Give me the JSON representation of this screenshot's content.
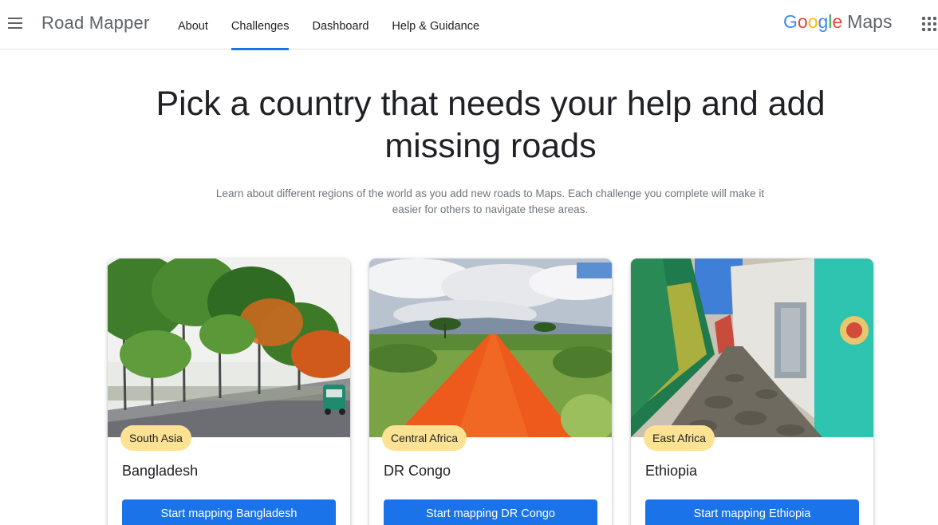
{
  "header": {
    "app_title": "Road Mapper",
    "nav": [
      {
        "label": "About",
        "active": false
      },
      {
        "label": "Challenges",
        "active": true
      },
      {
        "label": "Dashboard",
        "active": false
      },
      {
        "label": "Help & Guidance",
        "active": false
      }
    ],
    "brand": {
      "google_letters": [
        {
          "char": "G",
          "color": "#4285F4"
        },
        {
          "char": "o",
          "color": "#EA4335"
        },
        {
          "char": "o",
          "color": "#FBBC05"
        },
        {
          "char": "g",
          "color": "#4285F4"
        },
        {
          "char": "l",
          "color": "#34A853"
        },
        {
          "char": "e",
          "color": "#EA4335"
        }
      ],
      "product": "Maps"
    },
    "icons": {
      "menu": "hamburger-menu-icon",
      "apps": "apps-grid-icon"
    }
  },
  "hero": {
    "headline": "Pick a country that needs your help and add missing roads",
    "subtext": "Learn about different regions of the world as you add new roads to Maps. Each challenge you complete will make it easier for others to navigate these areas."
  },
  "cards": [
    {
      "region": "South Asia",
      "country": "Bangladesh",
      "button": "Start mapping Bangladesh",
      "image": "tree-lined road with auto-rickshaw"
    },
    {
      "region": "Central Africa",
      "country": "DR Congo",
      "button": "Start mapping DR Congo",
      "image": "red dirt road through savanna"
    },
    {
      "region": "East Africa",
      "country": "Ethiopia",
      "button": "Start mapping Ethiopia",
      "image": "cobblestone alley with painted walls"
    }
  ],
  "colors": {
    "accent": "#1a73e8",
    "badge": "#fde293",
    "text": "#202124",
    "muted": "#70757a"
  }
}
